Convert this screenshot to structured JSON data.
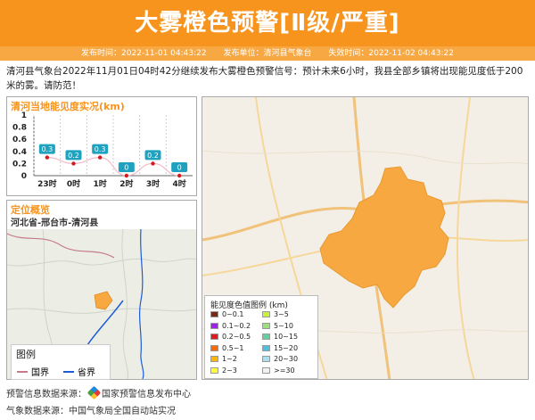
{
  "header": {
    "title": "大雾橙色预警[Ⅱ级/严重]"
  },
  "meta": {
    "publish_time": "发布时间：2022-11-01 04:43:22",
    "publisher": "发布单位：清河县气象台",
    "expire_time": "失效时间：2022-11-02 04:43:22"
  },
  "description": "清河县气象台2022年11月01日04时42分继续发布大雾橙色预警信号：预计未来6小时，我县全部乡镇将出现能见度低于200米的雾。请防范！",
  "visibility_panel": {
    "title": "清河当地能见度实况(km)"
  },
  "chart_data": {
    "type": "line",
    "categories": [
      "23时",
      "0时",
      "1时",
      "2时",
      "3时",
      "4时"
    ],
    "values": [
      0.3,
      0.2,
      0.3,
      0,
      0.2,
      0
    ],
    "labels": [
      "0.3",
      "0.2",
      "0.3",
      "0",
      "0.2",
      "0"
    ],
    "yticks": [
      "1",
      "0.8",
      "0.6",
      "0.4",
      "0.2",
      "0"
    ],
    "ylim": [
      0,
      1
    ],
    "grid": false
  },
  "location_panel": {
    "title": "定位概览",
    "subtitle": "河北省-邢台市-清河县"
  },
  "mini_legend": {
    "title": "图例",
    "items": [
      {
        "label": "国界",
        "color": "#c57b8b"
      },
      {
        "label": "省界",
        "color": "#1e5bd6"
      }
    ]
  },
  "legend": {
    "title": "能见度色值图例 (km)",
    "items": [
      {
        "label": "0~0.1",
        "color": "#7a2a12"
      },
      {
        "label": "0.1~0.2",
        "color": "#a020f0"
      },
      {
        "label": "0.2~0.5",
        "color": "#e31a1c"
      },
      {
        "label": "0.5~1",
        "color": "#ff6a00"
      },
      {
        "label": "1~2",
        "color": "#ffb400"
      },
      {
        "label": "2~3",
        "color": "#ffff33"
      },
      {
        "label": "3~5",
        "color": "#c8f03c"
      },
      {
        "label": "5~10",
        "color": "#9be17a"
      },
      {
        "label": "10~15",
        "color": "#5fd39b"
      },
      {
        "label": "15~20",
        "color": "#4fbfe0"
      },
      {
        "label": "20~30",
        "color": "#a9dff2"
      },
      {
        "label": ">=30",
        "color": "#f2f2f2"
      }
    ]
  },
  "footer": {
    "source1_label": "预警信息数据来源：",
    "source1_value": "国家预警信息发布中心",
    "source2": "气象数据来源：中国气象局全国自动站实况"
  },
  "colors": {
    "accent": "#f7941d",
    "fog_area": "#f7a840",
    "label_box": "#1fa2bf"
  }
}
